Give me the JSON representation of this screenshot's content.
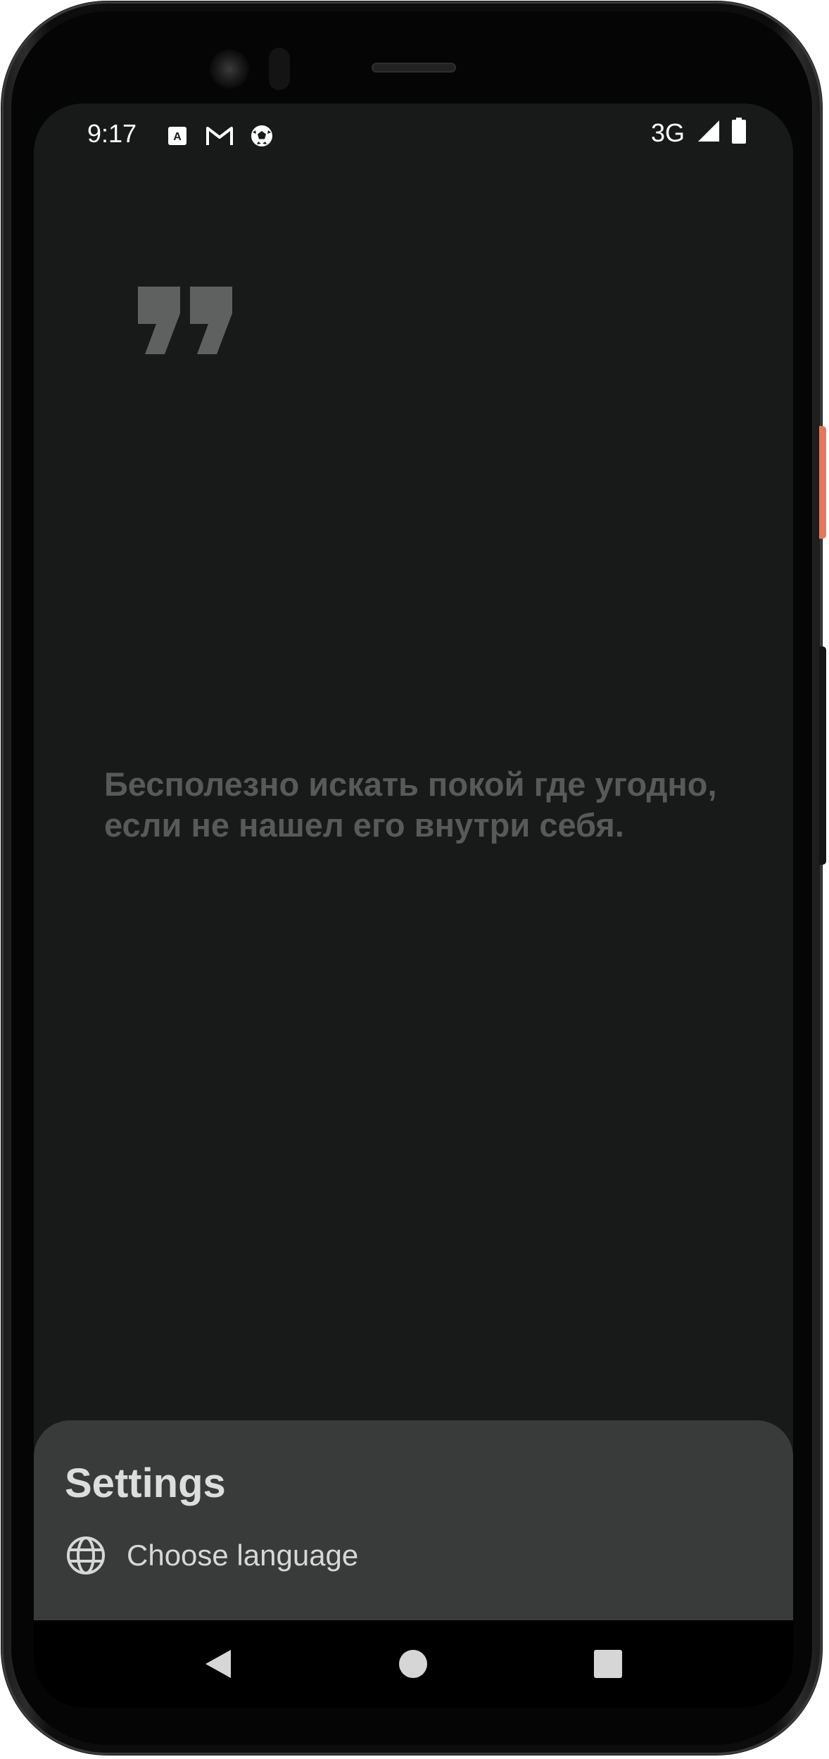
{
  "status_bar": {
    "time": "9:17",
    "network": "3G",
    "notification_icons": [
      "translate-app-icon",
      "gmail-icon",
      "soccer-ball-icon"
    ],
    "system_icons": [
      "signal-icon",
      "battery-icon"
    ]
  },
  "quote": {
    "mark_icon": "quote-mark-icon",
    "text": "Бесполезно искать покой где угодно, если не нашел его внутри себя."
  },
  "settings_sheet": {
    "title": "Settings",
    "items": [
      {
        "icon": "globe-icon",
        "label": "Choose language"
      }
    ]
  },
  "nav_bar": {
    "buttons": [
      "back-button",
      "home-button",
      "recents-button"
    ]
  },
  "colors": {
    "screen_bg": "#181919",
    "quote_text": "#585a59",
    "quote_mark": "#5f6160",
    "sheet_bg": "#383b3a",
    "sheet_text": "#dcdedd",
    "device_accent": "#e07a5f"
  }
}
